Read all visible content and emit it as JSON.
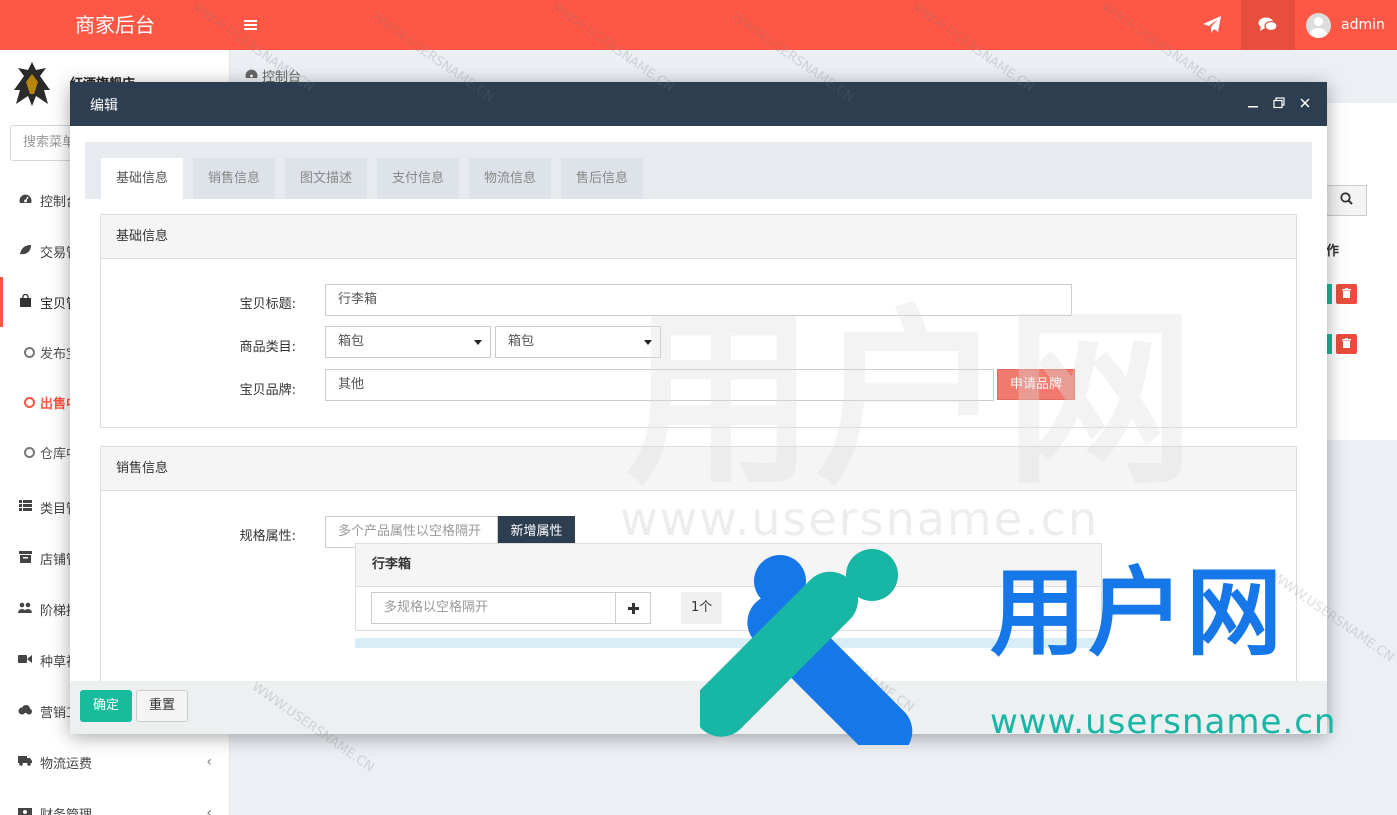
{
  "app": {
    "title": "商家后台",
    "user": "admin"
  },
  "sidebar": {
    "shop_name": "红酒旗舰店",
    "search_placeholder": "搜索菜单",
    "items": [
      {
        "label": "控制台",
        "icon": "dashboard-icon"
      },
      {
        "label": "交易管理",
        "icon": "leaf-icon"
      },
      {
        "label": "宝贝管理",
        "icon": "shopping-bag-icon"
      },
      {
        "label": "类目管理",
        "icon": "list-icon"
      },
      {
        "label": "店铺管理",
        "icon": "archive-icon"
      },
      {
        "label": "阶梯拼团",
        "icon": "users-icon"
      },
      {
        "label": "种草视频",
        "icon": "video-icon"
      },
      {
        "label": "营销工具",
        "icon": "cloud-icon"
      },
      {
        "label": "物流运费",
        "icon": "truck-icon"
      },
      {
        "label": "财务管理",
        "icon": "money-icon"
      }
    ],
    "sub_items": [
      {
        "label": "发布宝贝"
      },
      {
        "label": "出售中的宝贝"
      },
      {
        "label": "仓库中的宝贝"
      }
    ]
  },
  "breadcrumb": {
    "label": "控制台"
  },
  "background_table": {
    "op_header": "操作"
  },
  "modal": {
    "title": "编辑",
    "tabs": [
      {
        "label": "基础信息"
      },
      {
        "label": "销售信息"
      },
      {
        "label": "图文描述"
      },
      {
        "label": "支付信息"
      },
      {
        "label": "物流信息"
      },
      {
        "label": "售后信息"
      }
    ],
    "basic": {
      "header": "基础信息",
      "title_label": "宝贝标题:",
      "title_value": "行李箱",
      "category_label": "商品类目:",
      "category_1": "箱包",
      "category_2": "箱包",
      "brand_label": "宝贝品牌:",
      "brand_value": "其他",
      "apply_brand": "申请品牌"
    },
    "sales": {
      "header": "销售信息",
      "spec_label": "规格属性:",
      "spec_placeholder": "多个产品属性以空格隔开",
      "add_attr": "新增属性",
      "spec_group_title": "行李箱",
      "spec_value_placeholder": "多规格以空格隔开",
      "count": "1个"
    },
    "footer": {
      "ok": "确定",
      "reset": "重置"
    }
  },
  "watermark": {
    "brand": "用户网",
    "url": "www.usersname.cn",
    "diagonal": "WWW.USERSNAME.CN"
  }
}
